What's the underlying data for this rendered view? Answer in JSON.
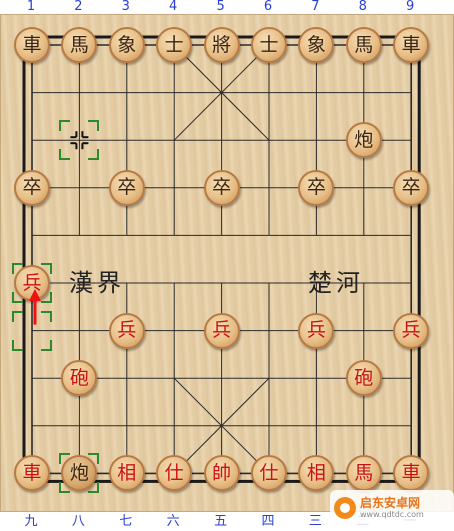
{
  "files_top": [
    "1",
    "2",
    "3",
    "4",
    "5",
    "6",
    "7",
    "8",
    "9"
  ],
  "files_bottom": [
    "九",
    "八",
    "七",
    "六",
    "五",
    "四",
    "三",
    "二",
    "一"
  ],
  "river": {
    "left": "漢界",
    "right": "楚河"
  },
  "pieces": [
    {
      "name": "black-chariot-left",
      "label": "車",
      "side": "black",
      "col": 0,
      "row": 0
    },
    {
      "name": "black-horse-left",
      "label": "馬",
      "side": "black",
      "col": 1,
      "row": 0
    },
    {
      "name": "black-elephant-left",
      "label": "象",
      "side": "black",
      "col": 2,
      "row": 0
    },
    {
      "name": "black-advisor-left",
      "label": "士",
      "side": "black",
      "col": 3,
      "row": 0
    },
    {
      "name": "black-general",
      "label": "將",
      "side": "black",
      "col": 4,
      "row": 0
    },
    {
      "name": "black-advisor-right",
      "label": "士",
      "side": "black",
      "col": 5,
      "row": 0
    },
    {
      "name": "black-elephant-right",
      "label": "象",
      "side": "black",
      "col": 6,
      "row": 0
    },
    {
      "name": "black-horse-right",
      "label": "馬",
      "side": "black",
      "col": 7,
      "row": 0
    },
    {
      "name": "black-chariot-right",
      "label": "車",
      "side": "black",
      "col": 8,
      "row": 0
    },
    {
      "name": "black-cannon",
      "label": "炮",
      "side": "black",
      "col": 7,
      "row": 2
    },
    {
      "name": "black-soldier-1",
      "label": "卒",
      "side": "black",
      "col": 0,
      "row": 3
    },
    {
      "name": "black-soldier-3",
      "label": "卒",
      "side": "black",
      "col": 2,
      "row": 3
    },
    {
      "name": "black-soldier-5",
      "label": "卒",
      "side": "black",
      "col": 4,
      "row": 3
    },
    {
      "name": "black-soldier-7",
      "label": "卒",
      "side": "black",
      "col": 6,
      "row": 3
    },
    {
      "name": "black-soldier-9",
      "label": "卒",
      "side": "black",
      "col": 8,
      "row": 3
    },
    {
      "name": "red-soldier-moved",
      "label": "兵",
      "side": "red",
      "col": 0,
      "row": 5
    },
    {
      "name": "red-soldier-3",
      "label": "兵",
      "side": "red",
      "col": 2,
      "row": 6
    },
    {
      "name": "red-soldier-5",
      "label": "兵",
      "side": "red",
      "col": 4,
      "row": 6
    },
    {
      "name": "red-soldier-7",
      "label": "兵",
      "side": "red",
      "col": 6,
      "row": 6
    },
    {
      "name": "red-soldier-9",
      "label": "兵",
      "side": "red",
      "col": 8,
      "row": 6
    },
    {
      "name": "red-cannon-left",
      "label": "砲",
      "side": "red",
      "col": 1,
      "row": 7
    },
    {
      "name": "red-cannon-right",
      "label": "砲",
      "side": "red",
      "col": 7,
      "row": 7
    },
    {
      "name": "red-chariot-left",
      "label": "車",
      "side": "red",
      "col": 0,
      "row": 9
    },
    {
      "name": "red-cannon-selected",
      "label": "炮",
      "side": "black",
      "col": 1,
      "row": 9
    },
    {
      "name": "red-elephant-left",
      "label": "相",
      "side": "red",
      "col": 2,
      "row": 9
    },
    {
      "name": "red-advisor-left",
      "label": "仕",
      "side": "red",
      "col": 3,
      "row": 9
    },
    {
      "name": "red-general",
      "label": "帥",
      "side": "red",
      "col": 4,
      "row": 9
    },
    {
      "name": "red-advisor-right",
      "label": "仕",
      "side": "red",
      "col": 5,
      "row": 9
    },
    {
      "name": "red-elephant-right",
      "label": "相",
      "side": "red",
      "col": 6,
      "row": 9
    },
    {
      "name": "red-horse-right",
      "label": "馬",
      "side": "red",
      "col": 7,
      "row": 9
    },
    {
      "name": "red-chariot-right",
      "label": "車",
      "side": "red",
      "col": 8,
      "row": 9
    }
  ],
  "last_move": {
    "from": {
      "col": 0,
      "row": 6
    },
    "to": {
      "col": 0,
      "row": 5
    }
  },
  "empty_markers": [
    {
      "col": 1,
      "row": 2
    }
  ],
  "selected": [
    {
      "col": 1,
      "row": 2
    },
    {
      "col": 0,
      "row": 5
    },
    {
      "col": 0,
      "row": 6
    },
    {
      "col": 1,
      "row": 9
    }
  ],
  "watermark": {
    "title": "启东安卓网",
    "url": "www.qdtdc.com"
  }
}
